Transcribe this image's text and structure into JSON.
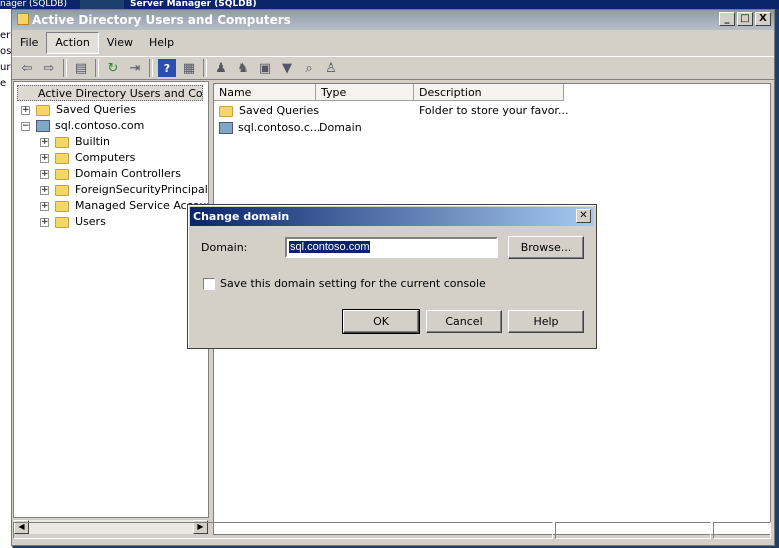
{
  "background": {
    "left_title": "nager (SQLDB)",
    "left_fragments": [
      "er",
      "ost",
      "ur",
      "e"
    ],
    "right_title": "Server Manager (SQLDB)"
  },
  "window": {
    "title": "Active Directory Users and Computers",
    "controls": {
      "minimize": "_",
      "maximize": "□",
      "close": "X"
    }
  },
  "menu": [
    "File",
    "Action",
    "View",
    "Help"
  ],
  "tree": {
    "root": "Active Directory Users and Comput",
    "saved_queries": "Saved Queries",
    "domain": "sql.contoso.com",
    "children": [
      "Builtin",
      "Computers",
      "Domain Controllers",
      "ForeignSecurityPrincipals",
      "Managed Service Accounts",
      "Users"
    ]
  },
  "list": {
    "columns": [
      "Name",
      "Type",
      "Description"
    ],
    "rows": [
      {
        "name": "Saved Queries",
        "type": "",
        "description": "Folder to store your favor..."
      },
      {
        "name": "sql.contoso.c...",
        "type": "Domain",
        "description": ""
      }
    ]
  },
  "dialog": {
    "title": "Change domain",
    "domain_label": "Domain:",
    "domain_value": "sql.contoso.com",
    "browse_label": "Browse...",
    "checkbox_label": "Save this domain setting for the current console",
    "ok_label": "OK",
    "cancel_label": "Cancel",
    "help_label": "Help"
  },
  "colors": {
    "title_active": "#0a246a",
    "title_inactive": "#8f9aa8",
    "face": "#d4d0c8"
  }
}
